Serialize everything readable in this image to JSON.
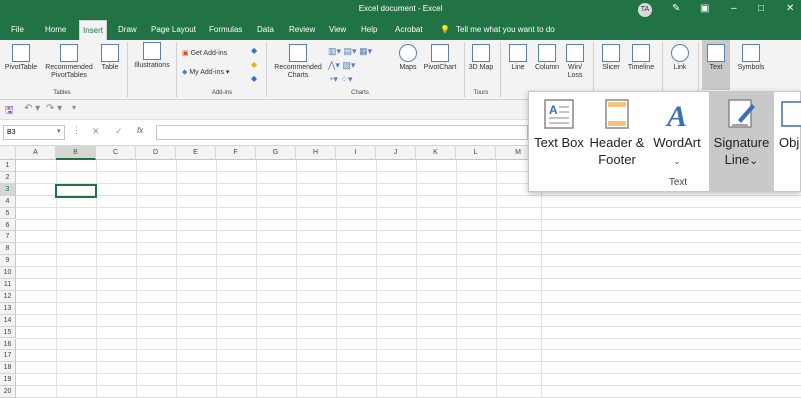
{
  "window": {
    "title": "Excel document  -  Excel",
    "user_initials": "TA"
  },
  "tabs": [
    "File",
    "Home",
    "Insert",
    "Draw",
    "Page Layout",
    "Formulas",
    "Data",
    "Review",
    "View",
    "Help",
    "Acrobat"
  ],
  "tell_me": "Tell me what you want to do",
  "ribbon": {
    "pivottable": "PivotTable",
    "recommended_pivottables": "Recommended PivotTables",
    "table": "Table",
    "tables_group": "Tables",
    "illustrations": "Illustrations",
    "get_addins": "Get Add-ins",
    "my_addins": "My Add-ins",
    "addins_group": "Add-ins",
    "recommended_charts": "Recommended Charts",
    "charts_group": "Charts",
    "maps": "Maps",
    "pivotchart": "PivotChart",
    "map_3d": "3D Map",
    "tours_group": "Tours",
    "line": "Line",
    "column": "Column",
    "winloss": "Win/ Loss",
    "slicer": "Slicer",
    "timeline": "Timeline",
    "link": "Link",
    "text": "Text",
    "symbols": "Symbols"
  },
  "namebox": "B3",
  "fx": "fx",
  "columns": [
    "A",
    "B",
    "C",
    "D",
    "E",
    "F",
    "G",
    "H",
    "I",
    "J",
    "K",
    "L",
    "M"
  ],
  "rows": [
    "1",
    "2",
    "3",
    "4",
    "5",
    "6",
    "7",
    "8",
    "9",
    "10",
    "11",
    "12",
    "13",
    "14",
    "15",
    "16",
    "17",
    "18",
    "19",
    "20"
  ],
  "text_popup": {
    "text_box": "Text Box",
    "header_footer": "Header & Footer",
    "wordart": "WordArt",
    "signature_line": "Signature Line",
    "object": "Obj",
    "group_label": "Text"
  },
  "colors": {
    "brand": "#217346",
    "selected": "#c9c9c9"
  }
}
